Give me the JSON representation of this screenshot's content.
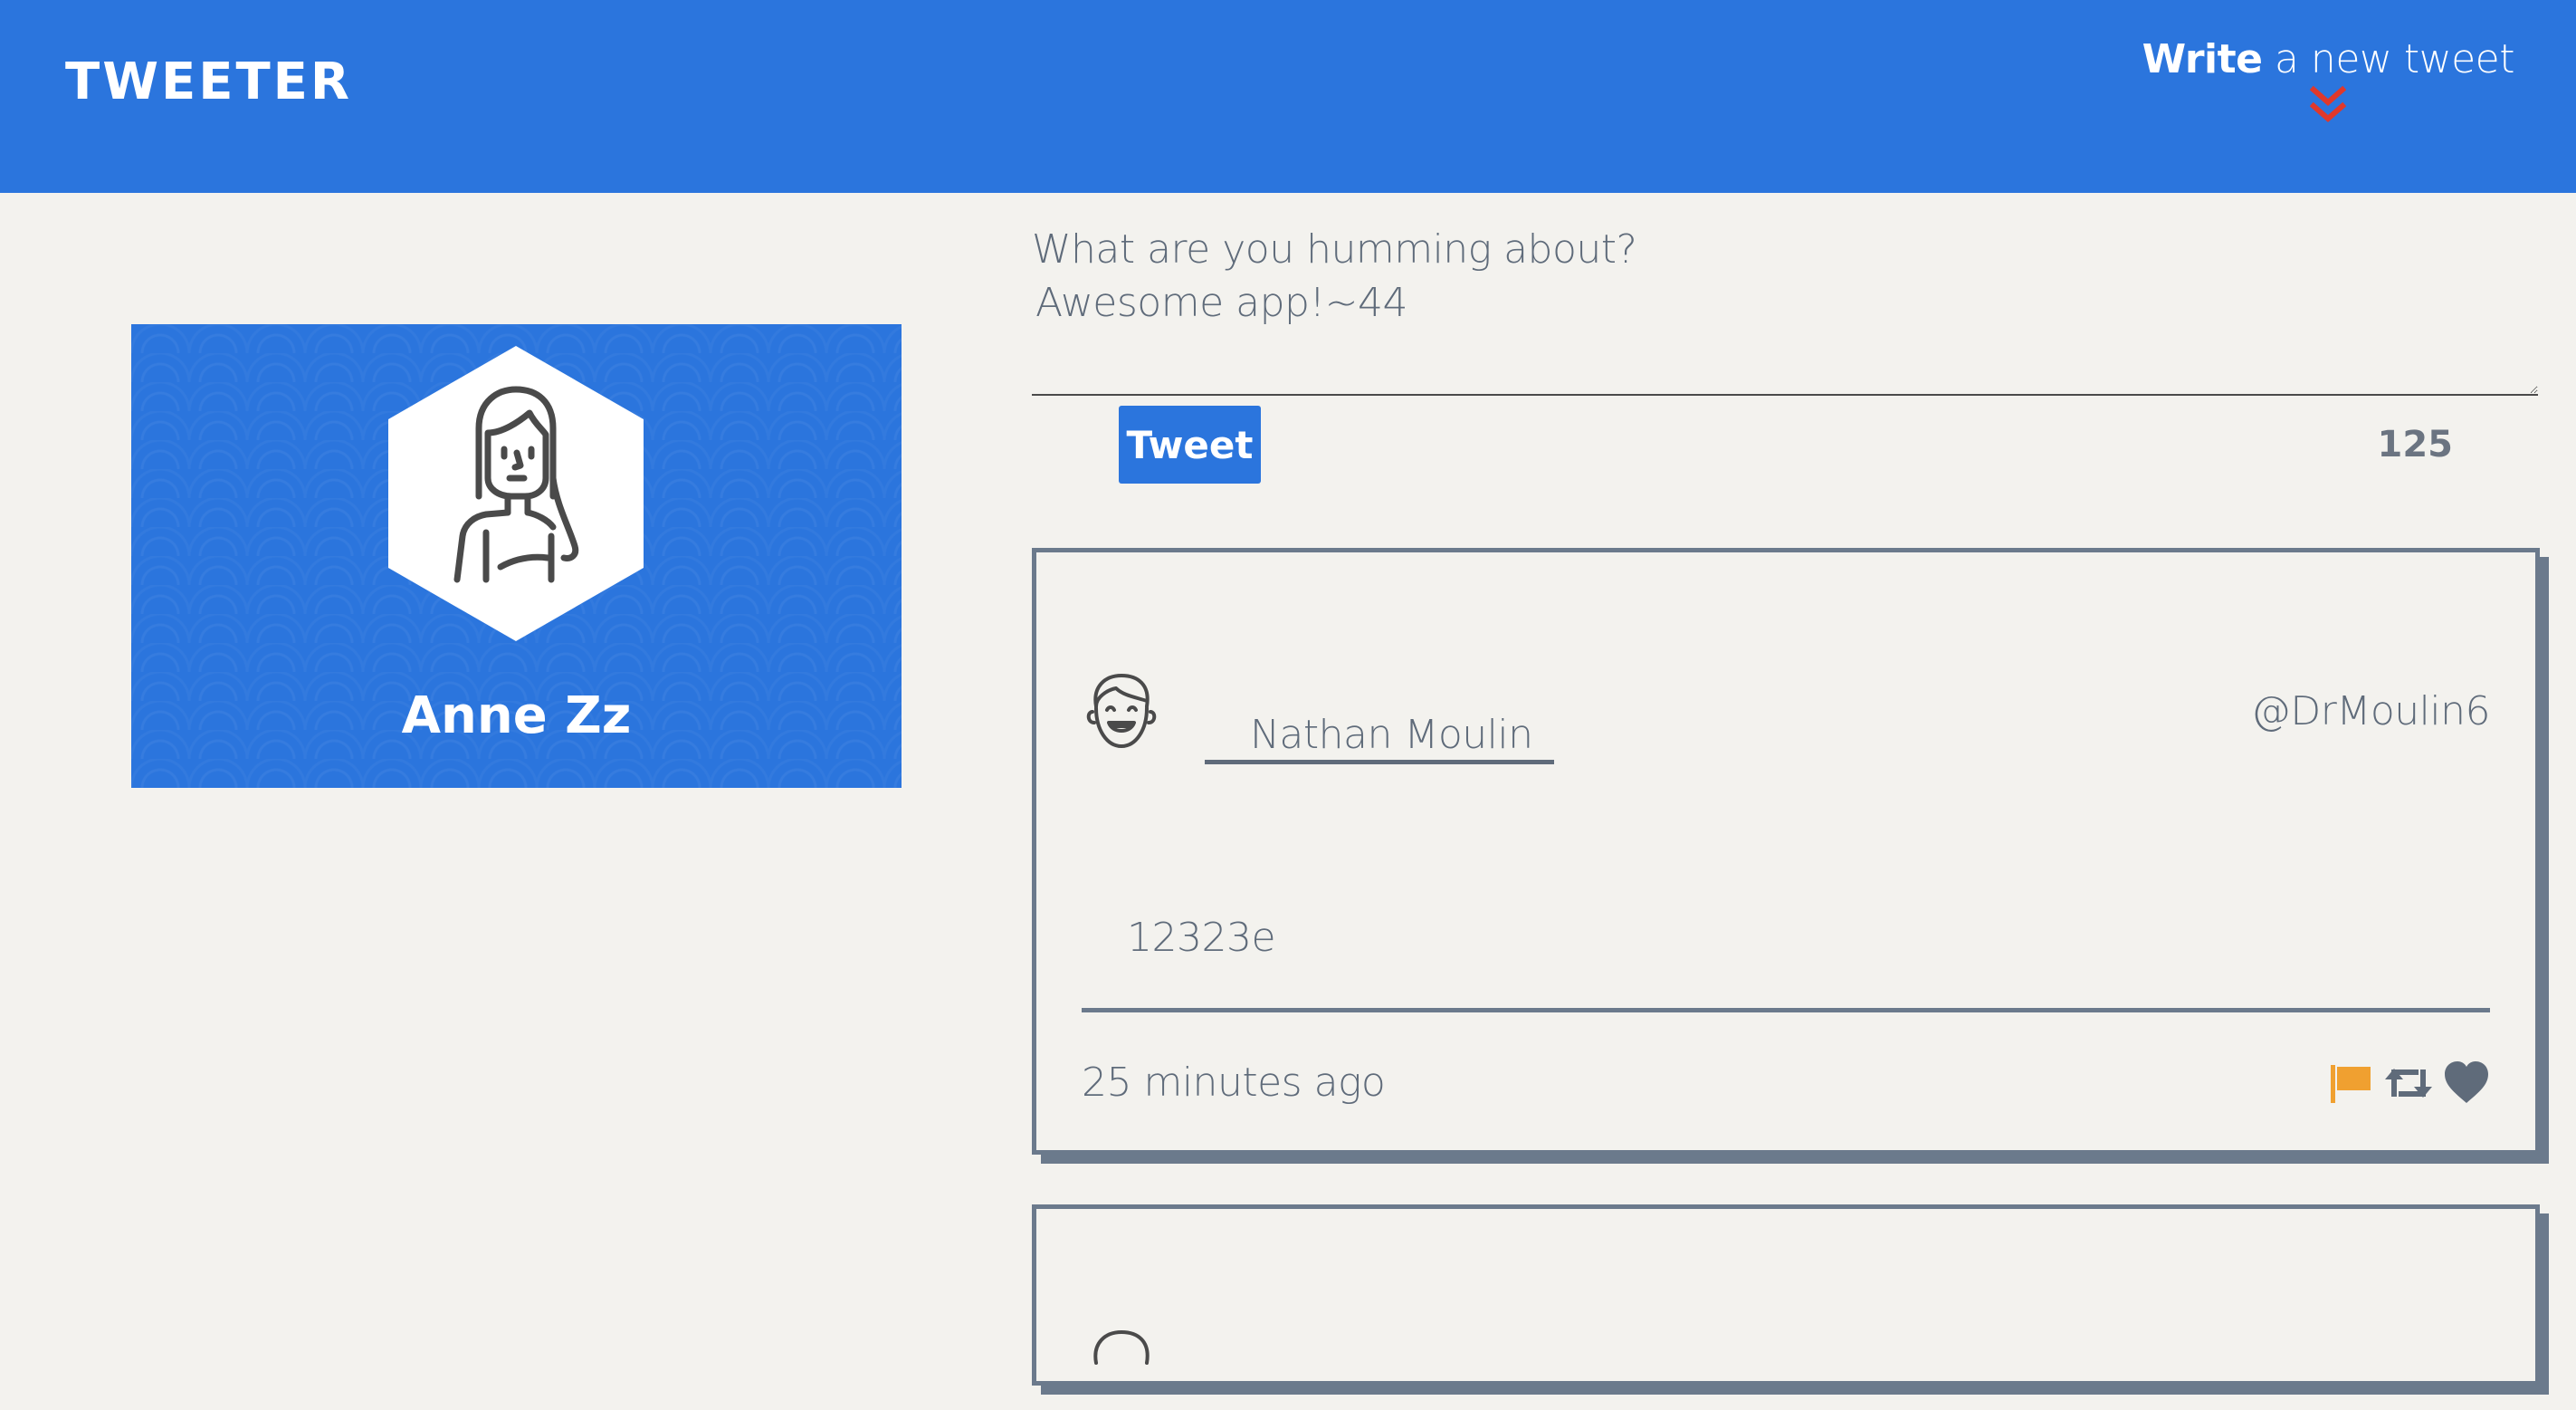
{
  "nav": {
    "logo": "TWEETER",
    "compose_toggle_bold": "Write",
    "compose_toggle_rest": " a new tweet",
    "chevron_color": "#e0382b"
  },
  "colors": {
    "brand_blue": "#2b75dd",
    "background": "#f3f2ee",
    "border_gray": "#6b7a8c",
    "text_gray": "#5f6b7a",
    "flag_orange": "#f0a030"
  },
  "profile": {
    "name": "Anne Zz",
    "avatar_icon": "woman-avatar-icon"
  },
  "compose": {
    "label": "What are you humming about?",
    "value": "Awesome app!~44",
    "button_label": "Tweet",
    "char_counter": "125"
  },
  "tweets": [
    {
      "avatar_icon": "smiling-man-avatar-icon",
      "author": "Nathan Moulin",
      "handle": "@DrMoulin6",
      "content": "12323e",
      "time": "25 minutes ago",
      "actions": [
        "flag-icon",
        "retweet-icon",
        "heart-icon"
      ]
    },
    {
      "avatar_icon": "man-avatar-icon"
    }
  ]
}
